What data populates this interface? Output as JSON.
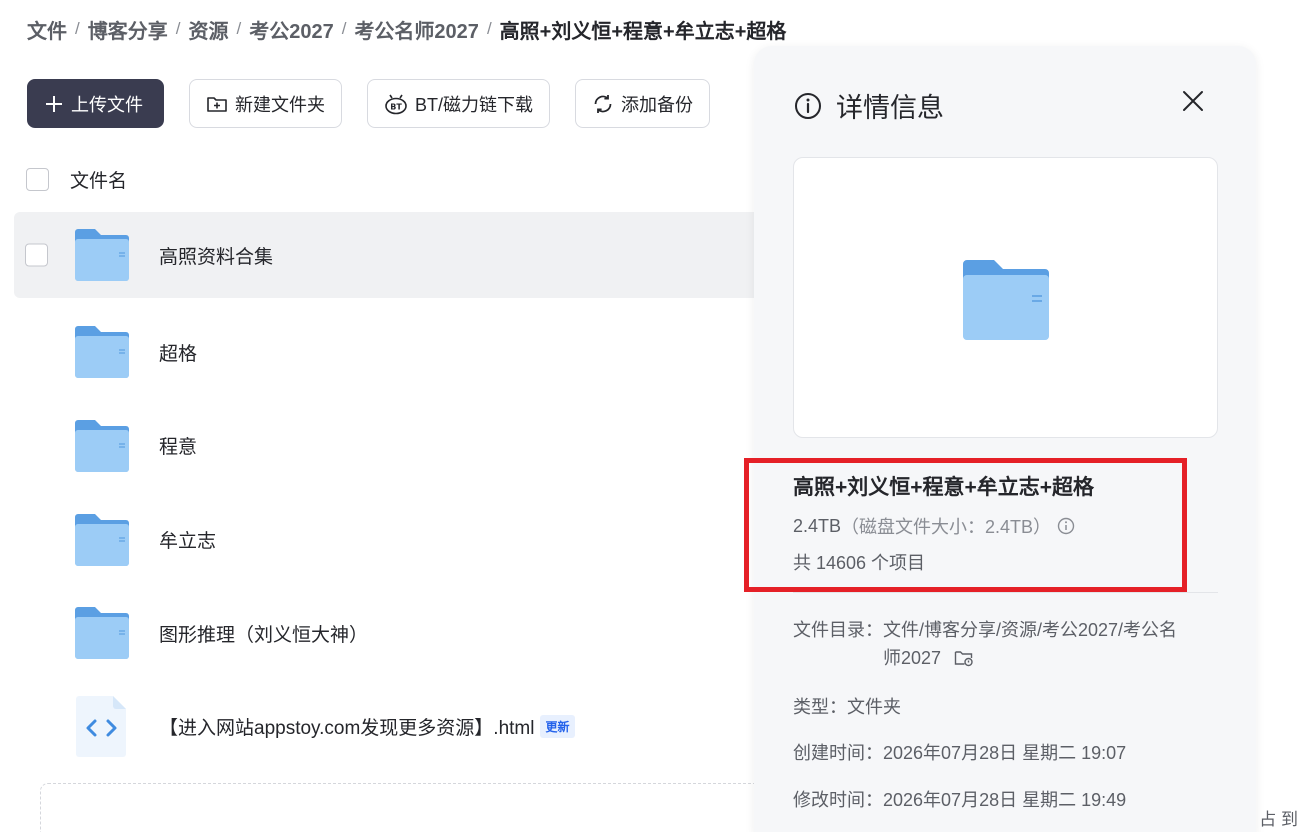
{
  "breadcrumb": {
    "items": [
      "文件",
      "博客分享",
      "资源",
      "考公2027",
      "考公名师2027"
    ],
    "current": "高照+刘义恒+程意+牟立志+超格",
    "separator": "/"
  },
  "toolbar": {
    "upload_label": "上传文件",
    "new_folder_label": "新建文件夹",
    "bt_label": "BT/磁力链下载",
    "backup_label": "添加备份"
  },
  "list": {
    "header_label": "文件名",
    "rows": [
      {
        "name": "高照资料合集",
        "type": "folder"
      },
      {
        "name": "超格",
        "type": "folder"
      },
      {
        "name": "程意",
        "type": "folder"
      },
      {
        "name": "牟立志",
        "type": "folder"
      },
      {
        "name": "图形推理（刘义恒大神）",
        "type": "folder"
      },
      {
        "name": "【进入网站appstoy.com发现更多资源】.html",
        "type": "html",
        "badge": "更新"
      }
    ]
  },
  "corner_text": "占 到",
  "details": {
    "title": "详情信息",
    "name": "高照+刘义恒+程意+牟立志+超格",
    "size": "2.4TB",
    "disk_size": "（磁盘文件大小：2.4TB）",
    "count": "共 14606 个项目",
    "dir_label": "文件目录：",
    "dir_value": "文件/博客分享/资源/考公2027/考公名师2027",
    "type_label": "类型：",
    "type_value": "文件夹",
    "created_label": "创建时间：",
    "created_value": "2026年07月28日 星期二 19:07",
    "modified_label": "修改时间：",
    "modified_value": "2026年07月28日 星期二 19:49"
  },
  "colors": {
    "primary_button": "#3a3c50",
    "highlight_border": "#e52027",
    "folder_blue": "#7db9f0",
    "badge_blue": "#2563eb"
  }
}
